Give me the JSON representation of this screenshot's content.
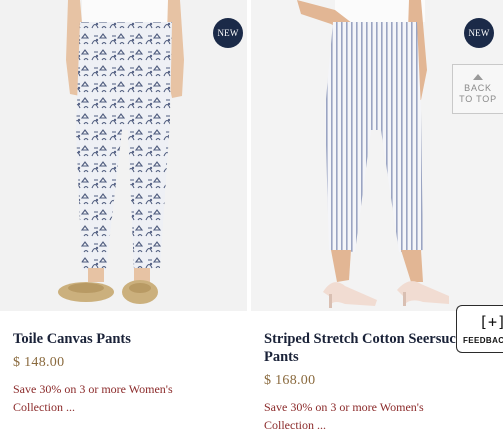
{
  "products": [
    {
      "badge": "NEW",
      "name": "Toile Canvas Pants",
      "price": "$ 148.00",
      "promo": "Save 30% on 3 or more Women's Collection ..."
    },
    {
      "badge": "NEW",
      "name": "Striped Stretch Cotton Seersucker Pants",
      "price": "$ 168.00",
      "promo": "Save 30% on 3 or more Women's Collection ..."
    }
  ],
  "back_to_top": {
    "line1": "BACK",
    "line2": "TO TOP"
  },
  "feedback": {
    "icon_text": "[+]",
    "label": "FEEDBACK"
  },
  "colors": {
    "badge": "#1b2a48",
    "name": "#1a2238",
    "price": "#8a6a3e",
    "promo": "#8b2a2a"
  }
}
